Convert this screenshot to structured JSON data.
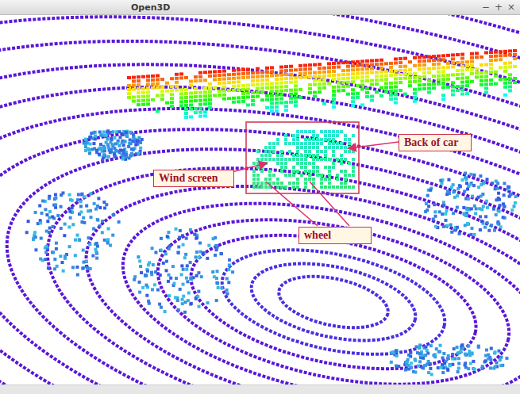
{
  "window": {
    "title": "Open3D",
    "controls": [
      "−",
      "+",
      "×"
    ]
  },
  "annotations": [
    {
      "label": "Wind screen"
    },
    {
      "label": "Back of car"
    },
    {
      "label": "wheel"
    }
  ]
}
